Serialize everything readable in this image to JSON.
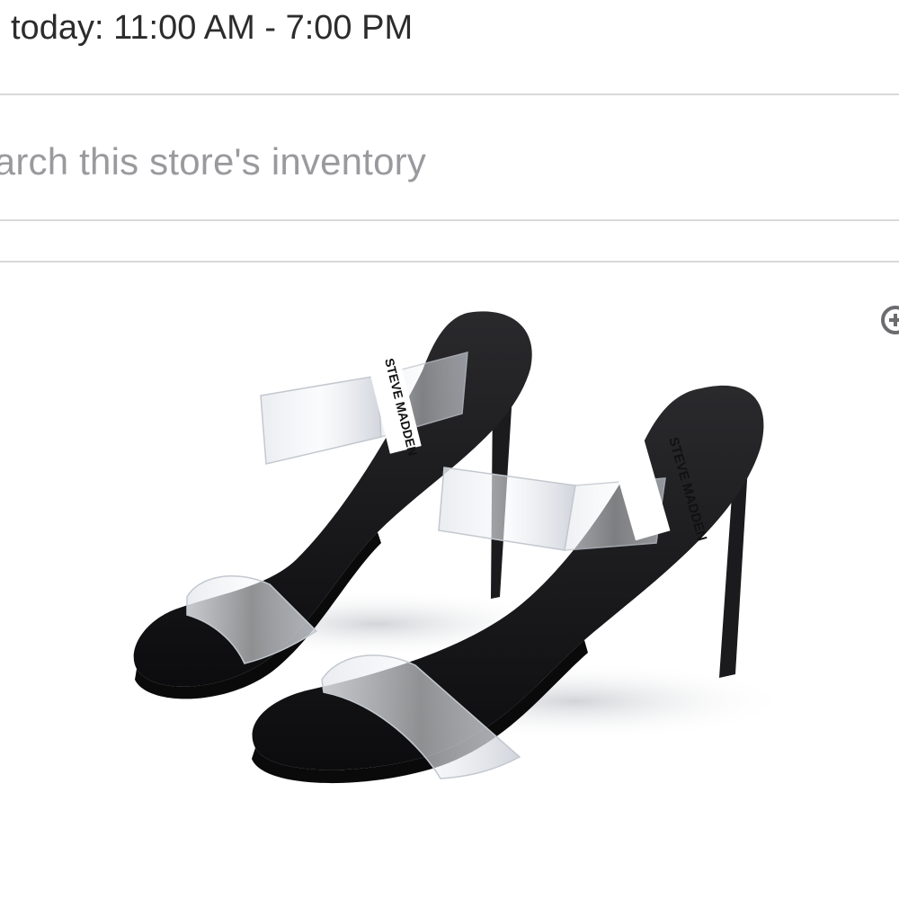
{
  "store": {
    "hours": "today: 11:00 AM - 7:00 PM"
  },
  "search": {
    "placeholder": "Search this store's inventory"
  },
  "product": {
    "brand_label_left": "STEVE MADDEN",
    "brand_label_right": "STEVE MADDEN",
    "zoom_icon": "zoom-in-icon"
  },
  "colors": {
    "divider": "#d9d9dc",
    "placeholder": "#9a9a9e",
    "text": "#2c2c2c",
    "shoe": "#161618"
  }
}
